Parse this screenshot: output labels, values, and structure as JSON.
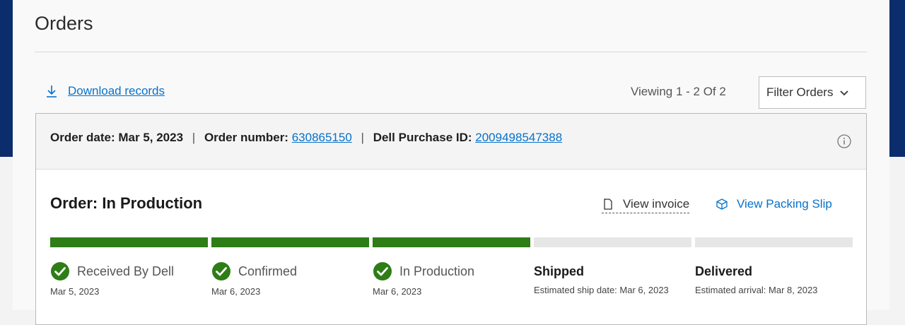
{
  "page": {
    "title": "Orders"
  },
  "toolbar": {
    "download_label": "Download records",
    "viewing_text": "Viewing 1 - 2 Of 2",
    "filter_label": "Filter Orders"
  },
  "order": {
    "date_label": "Order date:",
    "date_value": "Mar 5, 2023",
    "number_label": "Order number:",
    "number_value": "630865150",
    "purchase_label": "Dell Purchase ID:",
    "purchase_value": "2009498547388",
    "separator": "|",
    "status_title": "Order: In Production",
    "view_invoice": "View invoice",
    "view_packing_slip": "View Packing Slip",
    "progress": {
      "completed_steps": 3,
      "total_steps": 5
    },
    "steps": [
      {
        "label": "Received By Dell",
        "date": "Mar 5, 2023",
        "done": true
      },
      {
        "label": "Confirmed",
        "date": "Mar 6, 2023",
        "done": true
      },
      {
        "label": "In Production",
        "date": "Mar 6, 2023",
        "done": true
      },
      {
        "label": "Shipped",
        "date": "Estimated ship date: Mar 6, 2023",
        "done": false
      },
      {
        "label": "Delivered",
        "date": "Estimated arrival: Mar 8, 2023",
        "done": false
      }
    ]
  },
  "colors": {
    "link": "#0672cb",
    "success": "#2e7d16",
    "pending": "#e6e6e6",
    "banner": "#0c2d6b"
  },
  "icons": [
    "download-icon",
    "chevron-down-icon",
    "info-icon",
    "invoice-icon",
    "package-icon",
    "check-circle-icon"
  ]
}
